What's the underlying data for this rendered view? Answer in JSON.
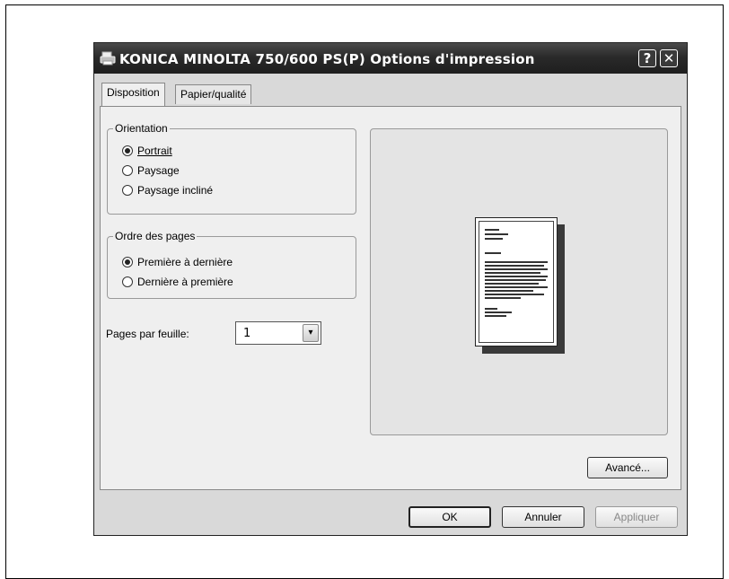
{
  "window": {
    "title": "KONICA MINOLTA 750/600 PS(P) Options d'impression",
    "help_symbol": "?",
    "close_symbol": "✕"
  },
  "tabs": [
    {
      "label": "Disposition",
      "active": true
    },
    {
      "label": "Papier/qualité",
      "active": false
    }
  ],
  "orientation": {
    "legend": "Orientation",
    "options": [
      {
        "label": "Portrait",
        "selected": true
      },
      {
        "label": "Paysage",
        "selected": false
      },
      {
        "label": "Paysage incliné",
        "selected": false
      }
    ]
  },
  "page_order": {
    "legend": "Ordre des pages",
    "options": [
      {
        "label": "Première à dernière",
        "selected": true
      },
      {
        "label": "Dernière à première",
        "selected": false
      }
    ]
  },
  "pages_per_sheet": {
    "label": "Pages par feuille:",
    "value": "1",
    "arrow": "▾"
  },
  "buttons": {
    "advanced": "Avancé...",
    "ok": "OK",
    "cancel": "Annuler",
    "apply": "Appliquer"
  },
  "icons": {
    "title_icon": "printer-icon",
    "preview": "page-preview-icon"
  }
}
